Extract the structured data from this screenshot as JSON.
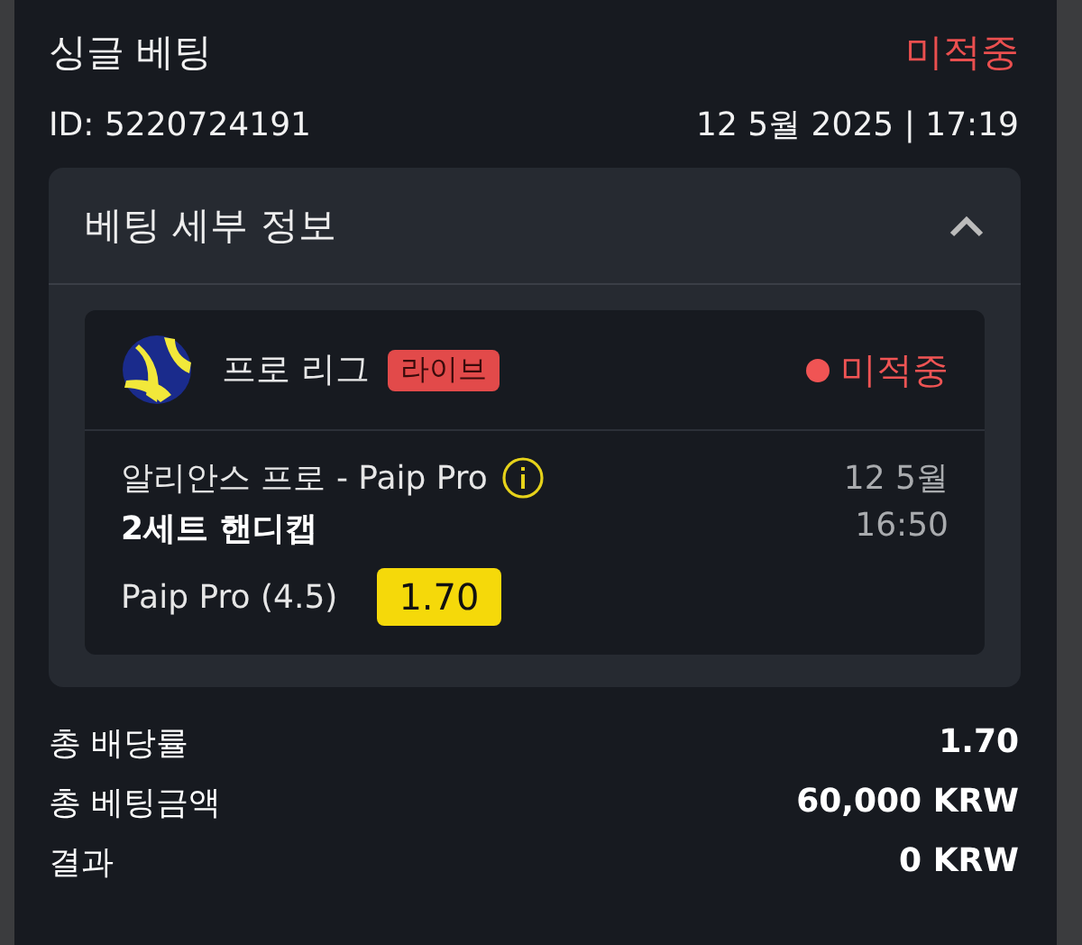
{
  "bet": {
    "title": "싱글 베팅",
    "status": "미적중",
    "id": "ID: 5220724191",
    "datetime": "12 5월 2025 | 17:19"
  },
  "details": {
    "title": "베팅 세부 정보",
    "expanded": true,
    "event": {
      "league": "프로 리그",
      "badge": "라이브",
      "status": "미적중",
      "match": "알리안스 프로 - Paip Pro",
      "date": "12 5월",
      "market": "2세트 핸디캡",
      "time": "16:50",
      "selection": "Paip Pro (4.5)",
      "odds": "1.70"
    }
  },
  "summary": [
    {
      "label": "총 배당률",
      "value": "1.70"
    },
    {
      "label": "총 베팅금액",
      "value": "60,000 KRW"
    },
    {
      "label": "결과",
      "value": "0 KRW"
    }
  ]
}
